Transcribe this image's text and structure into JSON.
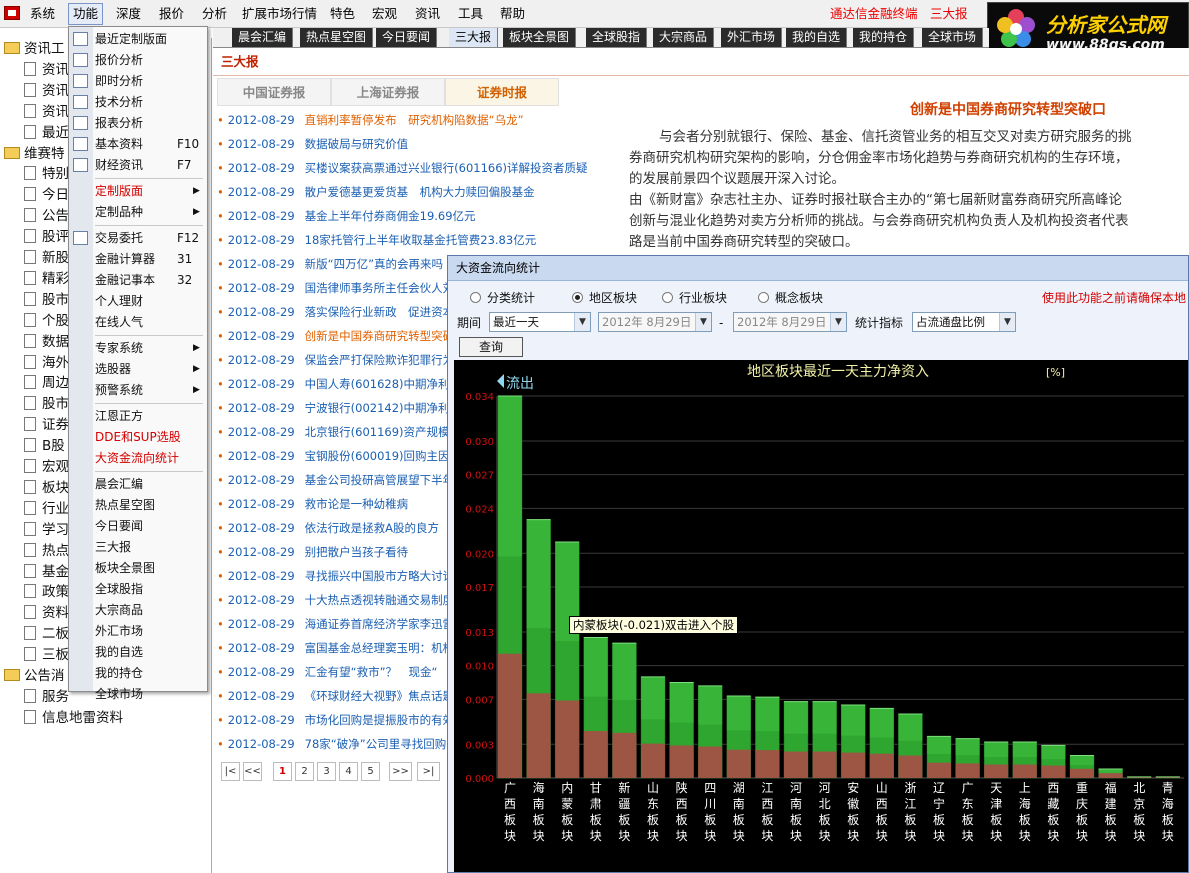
{
  "menubar": {
    "items": [
      "系统",
      "功能",
      "深度",
      "报价",
      "分析",
      "扩展市场行情",
      "特色",
      "宏观",
      "资讯",
      "工具",
      "帮助"
    ],
    "right_title": "通达信金融终端　三大报"
  },
  "brand": {
    "name": "分析家公式网",
    "url": "www.88gs.com"
  },
  "tree": {
    "nodes": [
      {
        "label": "资讯工",
        "kind": "folder"
      },
      {
        "label": "资讯",
        "kind": "doc"
      },
      {
        "label": "资讯",
        "kind": "doc"
      },
      {
        "label": "资讯",
        "kind": "doc"
      },
      {
        "label": "最近",
        "kind": "doc"
      },
      {
        "label": "维赛特",
        "kind": "folder"
      },
      {
        "label": "特别",
        "kind": "doc"
      },
      {
        "label": "今日",
        "kind": "doc"
      },
      {
        "label": "公告",
        "kind": "doc"
      },
      {
        "label": "股评",
        "kind": "doc"
      },
      {
        "label": "新股",
        "kind": "doc"
      },
      {
        "label": "精彩",
        "kind": "doc"
      },
      {
        "label": "股市",
        "kind": "doc"
      },
      {
        "label": "个股",
        "kind": "doc"
      },
      {
        "label": "数据",
        "kind": "doc"
      },
      {
        "label": "海外",
        "kind": "doc"
      },
      {
        "label": "周边",
        "kind": "doc"
      },
      {
        "label": "股市",
        "kind": "doc"
      },
      {
        "label": "证券",
        "kind": "doc"
      },
      {
        "label": "B股",
        "kind": "doc"
      },
      {
        "label": "宏观",
        "kind": "doc"
      },
      {
        "label": "板块",
        "kind": "doc"
      },
      {
        "label": "行业",
        "kind": "doc"
      },
      {
        "label": "学习",
        "kind": "doc"
      },
      {
        "label": "热点",
        "kind": "doc"
      },
      {
        "label": "基金",
        "kind": "doc"
      },
      {
        "label": "政策",
        "kind": "doc"
      },
      {
        "label": "资料",
        "kind": "doc"
      },
      {
        "label": "二板",
        "kind": "doc"
      },
      {
        "label": "三板",
        "kind": "doc"
      },
      {
        "label": "公告消",
        "kind": "folder"
      },
      {
        "label": "服务",
        "kind": "doc"
      },
      {
        "label": "信息地雷资料",
        "kind": "doc"
      }
    ]
  },
  "dropdown": {
    "groups": [
      [
        {
          "label": "最近定制版面",
          "icon": "layout-icon"
        },
        {
          "label": "报价分析",
          "icon": "grid-icon"
        },
        {
          "label": "即时分析",
          "icon": "line-chart-icon"
        },
        {
          "label": "技术分析",
          "icon": "candlestick-icon"
        },
        {
          "label": "报表分析",
          "icon": "table-icon"
        },
        {
          "label": "基本资料",
          "shortcut": "F10",
          "icon": "f10-icon"
        },
        {
          "label": "财经资讯",
          "shortcut": "F7",
          "icon": "news-icon"
        }
      ],
      [
        {
          "label": "定制版面",
          "submenu": true,
          "red": true
        },
        {
          "label": "定制品种",
          "submenu": true
        }
      ],
      [
        {
          "label": "交易委托",
          "shortcut": "F12",
          "icon": "f12-icon"
        },
        {
          "label": "金融计算器",
          "shortcut": "31"
        },
        {
          "label": "金融记事本",
          "shortcut": "32"
        },
        {
          "label": "个人理财"
        },
        {
          "label": "在线人气"
        }
      ],
      [
        {
          "label": "专家系统",
          "submenu": true
        },
        {
          "label": "选股器",
          "submenu": true
        },
        {
          "label": "预警系统",
          "submenu": true
        }
      ],
      [
        {
          "label": "江恩正方"
        },
        {
          "label": "DDE和SUP选股",
          "red": true
        },
        {
          "label": "大资金流向统计",
          "red": true
        }
      ],
      [
        {
          "label": "晨会汇编"
        },
        {
          "label": "热点星空图"
        },
        {
          "label": "今日要闻"
        },
        {
          "label": "三大报"
        },
        {
          "label": "板块全景图"
        },
        {
          "label": "全球股指"
        },
        {
          "label": "大宗商品"
        },
        {
          "label": "外汇市场"
        },
        {
          "label": "我的自选"
        },
        {
          "label": "我的持仓"
        },
        {
          "label": "全球市场"
        }
      ]
    ]
  },
  "tabs": {
    "items": [
      "晨会汇编",
      "热点星空图",
      "今日要闻",
      "三大报",
      "板块全景图",
      "全球股指",
      "大宗商品",
      "外汇市场",
      "我的自选",
      "我的持仓",
      "全球市场"
    ],
    "active": "三大报"
  },
  "panel": {
    "title": "三大报",
    "subtabs": [
      "中国证券报",
      "上海证券报",
      "证券时报"
    ],
    "active_subtab": "证券时报",
    "news": [
      {
        "date": "2012-08-29",
        "title": "直销利率暂停发布　研究机构陷数据“乌龙”",
        "selected": true
      },
      {
        "date": "2012-08-29",
        "title": "数据破局与研究价值"
      },
      {
        "date": "2012-08-29",
        "title": "买楼议案获高票通过兴业银行(601166)详解投资者质疑"
      },
      {
        "date": "2012-08-29",
        "title": "散户爱德基更爱货基　机构大力赎回偏股基金"
      },
      {
        "date": "2012-08-29",
        "title": "基金上半年付券商佣金19.69亿元"
      },
      {
        "date": "2012-08-29",
        "title": "18家托管行上半年收取基金托管费23.83亿元"
      },
      {
        "date": "2012-08-29",
        "title": "新版“四万亿”真的会再来吗"
      },
      {
        "date": "2012-08-29",
        "title": "国浩律师事务所主任会伙人刘"
      },
      {
        "date": "2012-08-29",
        "title": "落实保险行业新政　促进资本"
      },
      {
        "date": "2012-08-29",
        "title": "创新是中国券商研究转型突破",
        "selected": true
      },
      {
        "date": "2012-08-29",
        "title": "保监会严打保险欺诈犯罪行为"
      },
      {
        "date": "2012-08-29",
        "title": "中国人寿(601628)中期净利下"
      },
      {
        "date": "2012-08-29",
        "title": "宁波银行(002142)中期净利增"
      },
      {
        "date": "2012-08-29",
        "title": "北京银行(601169)资产规模达"
      },
      {
        "date": "2012-08-29",
        "title": "宝钢股份(600019)回购主因是"
      },
      {
        "date": "2012-08-29",
        "title": "基金公司投研高管展望下半年"
      },
      {
        "date": "2012-08-29",
        "title": "救市论是一种幼稚病"
      },
      {
        "date": "2012-08-29",
        "title": "依法行政是拯救A股的良方"
      },
      {
        "date": "2012-08-29",
        "title": "别把散户当孩子看待"
      },
      {
        "date": "2012-08-29",
        "title": "寻找振兴中国股市方略大讨论"
      },
      {
        "date": "2012-08-29",
        "title": "十大热点透视转融通交易制度"
      },
      {
        "date": "2012-08-29",
        "title": "海通证券首席经济学家李迅雷"
      },
      {
        "date": "2012-08-29",
        "title": "富国基金总经理窦玉明：机构"
      },
      {
        "date": "2012-08-29",
        "title": "汇金有望“救市”？　现金“"
      },
      {
        "date": "2012-08-29",
        "title": "《环球财经大视野》焦点话题"
      },
      {
        "date": "2012-08-29",
        "title": "市场化回购是提振股市的有效"
      },
      {
        "date": "2012-08-29",
        "title": "78家“破净”公司里寻找回购"
      }
    ],
    "pager": {
      "first": "|<",
      "prev": "<<",
      "pages": [
        "1",
        "2",
        "3",
        "4",
        "5"
      ],
      "current": "1",
      "next": ">>",
      "last": ">|"
    }
  },
  "article": {
    "title": "创新是中国券商研究转型突破口",
    "paragraphs": [
      "与会者分别就银行、保险、基金、信托资管业务的相互交叉对卖方研究服务的挑",
      "券商研究机构研究架构的影响，分仓佣金率市场化趋势与券商研究机构的生存环境，",
      "的发展前景四个议题展开深入讨论。",
      "由《新财富》杂志社主办、证券时报社联合主办的“第七届新财富券商研究所高峰论",
      "创新与混业化趋势对卖方分析师的挑战。与会券商研究机构负责人及机构投资者代表",
      "路是当前中国券商研究转型的突破口。"
    ]
  },
  "fund_flow": {
    "title": "大资金流向统计",
    "radios": [
      "分类统计",
      "地区板块",
      "行业板块",
      "概念板块"
    ],
    "radio_selected": "地区板块",
    "warning": "使用此功能之前请确保本地",
    "period_label": "期间",
    "period_value": "最近一天",
    "date_from": "2012年 8月29日",
    "date_sep": "-",
    "date_to": "2012年 8月29日",
    "metric_label": "统计指标",
    "metric_value": "占流通盘比例",
    "query_label": "查询",
    "tooltip": "内蒙板块(-0.021)双击进入个股"
  },
  "chart_data": {
    "type": "bar",
    "title": "地区板块最近一天主力净资入",
    "title_unit": "[%]",
    "legend": "流出",
    "categories": [
      "广西板块",
      "海南板块",
      "内蒙板块",
      "甘肃板块",
      "新疆板块",
      "山东板块",
      "陕西板块",
      "四川板块",
      "湖南板块",
      "江西板块",
      "河南板块",
      "河北板块",
      "安徽板块",
      "山西板块",
      "浙江板块",
      "辽宁板块",
      "广东板块",
      "天津板块",
      "上海板块",
      "西藏板块",
      "重庆板块",
      "福建板块",
      "北京板块",
      "青海板块"
    ],
    "values": [
      0.034,
      0.023,
      0.021,
      0.0125,
      0.012,
      0.009,
      0.0085,
      0.0082,
      0.0073,
      0.0072,
      0.0068,
      0.0068,
      0.0065,
      0.0062,
      0.0057,
      0.0037,
      0.0035,
      0.0032,
      0.0032,
      0.0029,
      0.002,
      0.0008,
      0.0001,
      0.0001
    ],
    "yticks": [
      "0.034",
      "0.030",
      "0.027",
      "0.024",
      "0.020",
      "0.017",
      "0.013",
      "0.010",
      "0.007",
      "0.003",
      "0.000"
    ],
    "ylim": [
      0,
      0.034
    ],
    "grid": true,
    "colors": {
      "bar": "#2fa62f",
      "bar_top": "#45c845",
      "base": "#b04848",
      "axis_text": "#d01010",
      "title": "#f2f2a8",
      "grid": "#3a3a3a",
      "label": "#ffffff"
    }
  }
}
